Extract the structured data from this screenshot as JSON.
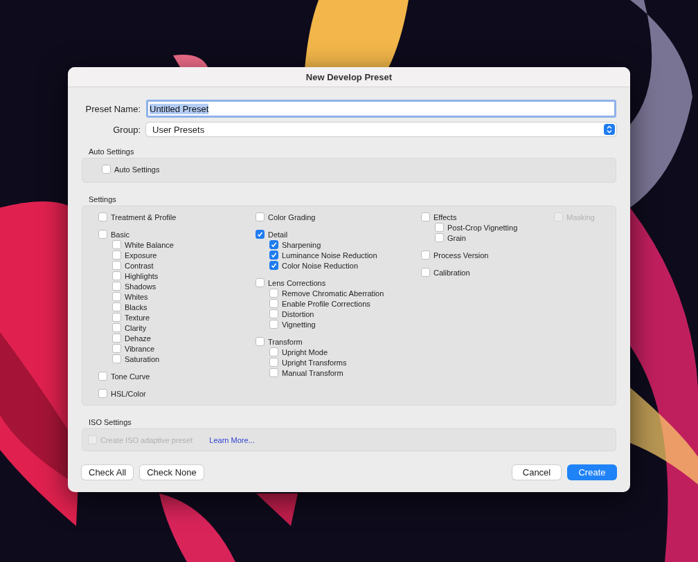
{
  "dialog": {
    "title": "New Develop Preset"
  },
  "preset_name": {
    "label": "Preset Name:",
    "value": "Untitled Preset",
    "selected": true
  },
  "group": {
    "label": "Group:",
    "value": "User Presets"
  },
  "auto_settings": {
    "heading": "Auto Settings",
    "option": {
      "label": "Auto Settings",
      "checked": false,
      "disabled": false
    }
  },
  "settings": {
    "heading": "Settings",
    "columns": [
      [
        {
          "label": "Treatment & Profile",
          "checked": false,
          "disabled": false
        },
        {
          "label": "Basic",
          "checked": false,
          "disabled": false,
          "children": [
            {
              "label": "White Balance",
              "checked": false,
              "disabled": false
            },
            {
              "label": "Exposure",
              "checked": false,
              "disabled": false
            },
            {
              "label": "Contrast",
              "checked": false,
              "disabled": false
            },
            {
              "label": "Highlights",
              "checked": false,
              "disabled": false
            },
            {
              "label": "Shadows",
              "checked": false,
              "disabled": false
            },
            {
              "label": "Whites",
              "checked": false,
              "disabled": false
            },
            {
              "label": "Blacks",
              "checked": false,
              "disabled": false
            },
            {
              "label": "Texture",
              "checked": false,
              "disabled": false
            },
            {
              "label": "Clarity",
              "checked": false,
              "disabled": false
            },
            {
              "label": "Dehaze",
              "checked": false,
              "disabled": false
            },
            {
              "label": "Vibrance",
              "checked": false,
              "disabled": false
            },
            {
              "label": "Saturation",
              "checked": false,
              "disabled": false
            }
          ]
        },
        {
          "label": "Tone Curve",
          "checked": false,
          "disabled": false
        },
        {
          "label": "HSL/Color",
          "checked": false,
          "disabled": false
        }
      ],
      [
        {
          "label": "Color Grading",
          "checked": false,
          "disabled": false
        },
        {
          "label": "Detail",
          "checked": true,
          "disabled": false,
          "children": [
            {
              "label": "Sharpening",
              "checked": true,
              "disabled": false
            },
            {
              "label": "Luminance Noise Reduction",
              "checked": true,
              "disabled": false
            },
            {
              "label": "Color Noise Reduction",
              "checked": true,
              "disabled": false
            }
          ]
        },
        {
          "label": "Lens Corrections",
          "checked": false,
          "disabled": false,
          "children": [
            {
              "label": "Remove Chromatic Aberration",
              "checked": false,
              "disabled": false
            },
            {
              "label": "Enable Profile Corrections",
              "checked": false,
              "disabled": false
            },
            {
              "label": "Distortion",
              "checked": false,
              "disabled": false
            },
            {
              "label": "Vignetting",
              "checked": false,
              "disabled": false
            }
          ]
        },
        {
          "label": "Transform",
          "checked": false,
          "disabled": false,
          "children": [
            {
              "label": "Upright Mode",
              "checked": false,
              "disabled": false
            },
            {
              "label": "Upright Transforms",
              "checked": false,
              "disabled": false
            },
            {
              "label": "Manual Transform",
              "checked": false,
              "disabled": false
            }
          ]
        }
      ],
      [
        {
          "label": "Effects",
          "checked": false,
          "disabled": false,
          "children": [
            {
              "label": "Post-Crop Vignetting",
              "checked": false,
              "disabled": false
            },
            {
              "label": "Grain",
              "checked": false,
              "disabled": false
            }
          ]
        },
        {
          "label": "Process Version",
          "checked": false,
          "disabled": false
        },
        {
          "label": "Calibration",
          "checked": false,
          "disabled": false
        }
      ],
      [
        {
          "label": "Masking",
          "checked": false,
          "disabled": true
        }
      ]
    ]
  },
  "iso_settings": {
    "heading": "ISO Settings",
    "option": {
      "label": "Create ISO adaptive preset",
      "checked": false,
      "disabled": true
    },
    "link": "Learn More..."
  },
  "buttons_left": [
    "Check All",
    "Check None"
  ],
  "buttons_right": [
    {
      "label": "Cancel",
      "primary": false
    },
    {
      "label": "Create",
      "primary": true
    }
  ]
}
